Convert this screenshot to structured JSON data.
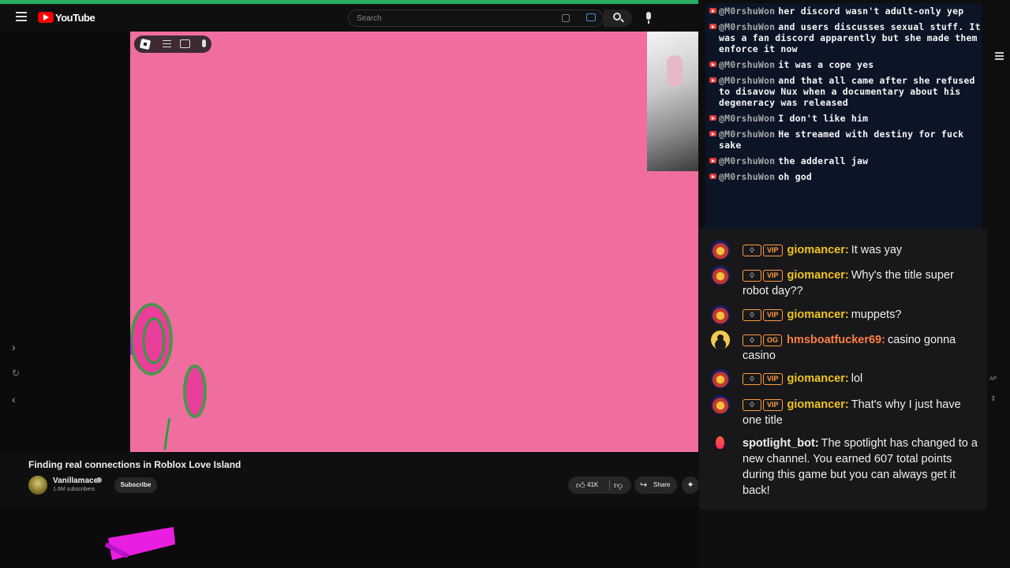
{
  "youtube": {
    "logo_text": "YouTube",
    "search_placeholder": "Search",
    "video_title": "Finding real connections in Roblox Love Island",
    "channel_name": "Vanillamace",
    "subscriber_count": "1.6M subscribers",
    "subscribe_label": "Subscribe",
    "like_count": "41K",
    "share_label": "Share"
  },
  "overlay_chat": [
    {
      "user": "@M0rshuWon",
      "text": "her discord wasn't adult-only yep"
    },
    {
      "user": "@M0rshuWon",
      "text": "and users discusses sexual stuff. It was a fan discord apparently but she made them enforce it now"
    },
    {
      "user": "@M0rshuWon",
      "text": "it was a cope yes"
    },
    {
      "user": "@M0rshuWon",
      "text": "and that all came after she refused to disavow Nux when a documentary about his degeneracy was released"
    },
    {
      "user": "@M0rshuWon",
      "text": "I don't like him"
    },
    {
      "user": "@M0rshuWon",
      "text": "He streamed with destiny for fuck sake"
    },
    {
      "user": "@M0rshuWon",
      "text": "the adderall jaw"
    },
    {
      "user": "@M0rshuWon",
      "text": "oh god"
    }
  ],
  "twitch_chat": [
    {
      "user": "giomancer:",
      "badge": "VIP",
      "text": "It was yay"
    },
    {
      "user": "giomancer:",
      "badge": "VIP",
      "text": "Why's the title super robot day??"
    },
    {
      "user": "giomancer:",
      "badge": "VIP",
      "text": "muppets?"
    },
    {
      "user": "hmsboatfucker69:",
      "badge": "OG",
      "text": "casino gonna casino"
    },
    {
      "user": "giomancer:",
      "badge": "VIP",
      "text": "lol"
    },
    {
      "user": "giomancer:",
      "badge": "VIP",
      "text": "That's why I just have one title"
    },
    {
      "user": "spotlight_bot:",
      "badge": "",
      "text": "The spotlight has changed to a new channel. You earned 607 total points during this game but you can always get it back!"
    }
  ],
  "side": {
    "ap_label": "AP"
  },
  "colors": {
    "video_background": "#f06da0",
    "vip_username": "#f0c419",
    "og_username": "#ff7f3f",
    "overlay_background": "#0c1628",
    "top_accent": "#27ae60"
  }
}
